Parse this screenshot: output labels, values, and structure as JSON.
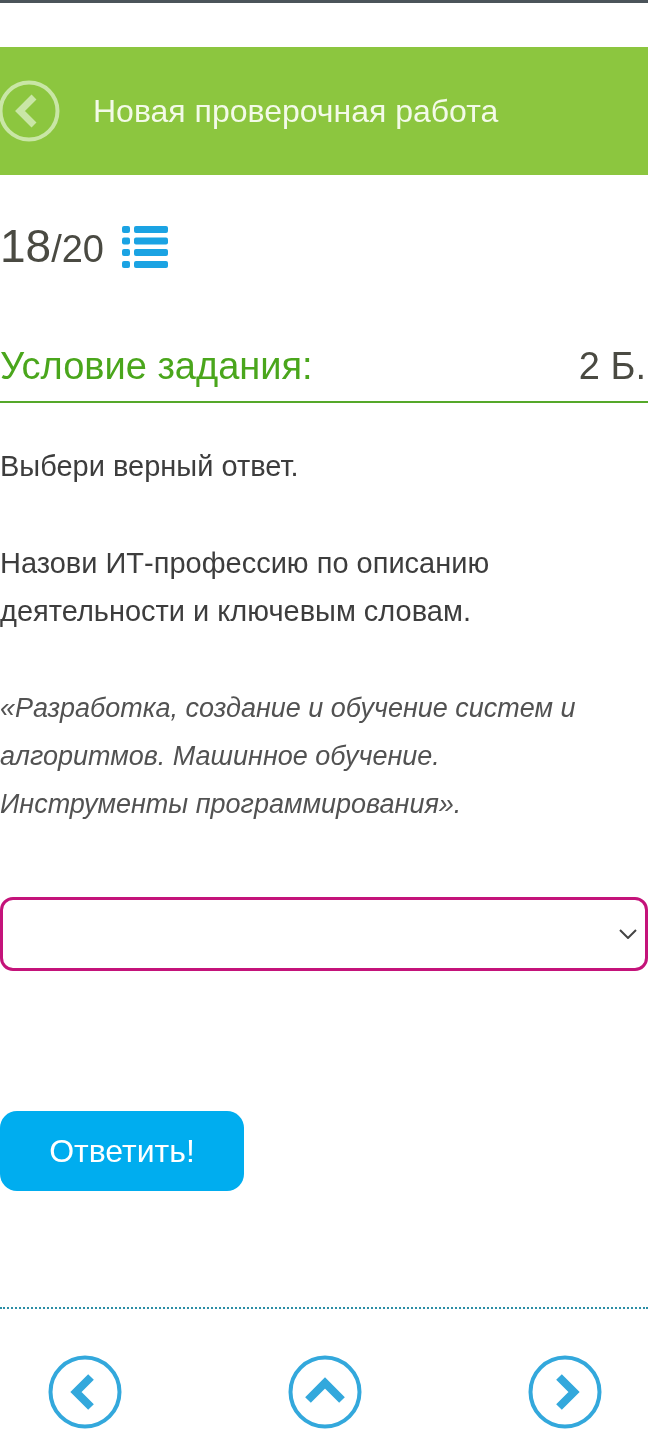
{
  "header": {
    "title": "Новая проверочная работа"
  },
  "counter": {
    "current": "18",
    "total": "/20"
  },
  "task": {
    "heading": "Условие задания:",
    "points": "2 Б.",
    "instruction": "Выбери верный ответ.",
    "question": "Назови ИТ-профессию по описанию деятельности и ключевым словам.",
    "quote": "«Разработка, создание и обучение систем и алгоритмов. Машинное обучение. Инструменты программирования»."
  },
  "submit_button": {
    "label": "Ответить!"
  }
}
